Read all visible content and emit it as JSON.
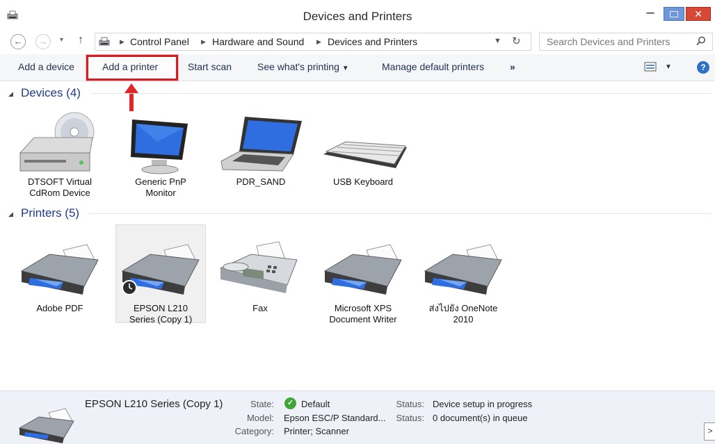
{
  "window": {
    "title": "Devices and Printers",
    "close_glyph": "✕",
    "minimize_glyph": "–"
  },
  "address": {
    "crumbs": [
      "Control Panel",
      "Hardware and Sound",
      "Devices and Printers"
    ],
    "search_placeholder": "Search Devices and Printers"
  },
  "toolbar": {
    "add_device": "Add a device",
    "add_printer": "Add a printer",
    "start_scan": "Start scan",
    "see_printing": "See what's printing",
    "manage_default": "Manage default printers",
    "more": "»"
  },
  "devices_group": {
    "header": "Devices (4)",
    "items": [
      {
        "name": "DTSOFT Virtual CdRom Device",
        "icon": "cdrom-drive-icon"
      },
      {
        "name": "Generic PnP Monitor",
        "icon": "monitor-icon"
      },
      {
        "name": "PDR_SAND",
        "icon": "laptop-icon"
      },
      {
        "name": "USB Keyboard",
        "icon": "keyboard-icon"
      }
    ]
  },
  "printers_group": {
    "header": "Printers (5)",
    "items": [
      {
        "name": "Adobe PDF",
        "icon": "printer-icon"
      },
      {
        "name": "EPSON L210 Series (Copy 1)",
        "icon": "printer-icon",
        "selected": true
      },
      {
        "name": "Fax",
        "icon": "fax-icon"
      },
      {
        "name": "Microsoft XPS Document Writer",
        "icon": "printer-icon"
      },
      {
        "name": "ส่งไปยัง OneNote 2010",
        "icon": "printer-icon"
      }
    ]
  },
  "details": {
    "name": "EPSON L210 Series (Copy 1)",
    "state_label": "State:",
    "state_value": "Default",
    "model_label": "Model:",
    "model_value": "Epson ESC/P Standard...",
    "category_label": "Category:",
    "category_value": "Printer; Scanner",
    "status_label": "Status:",
    "status_value_1": "Device setup in progress",
    "status_label_2": "Status:",
    "status_value_2": "0 document(s) in queue"
  },
  "colors": {
    "highlight": "#d21f25",
    "group_header": "#1e3a8a",
    "details_bg": "#eef2f8"
  }
}
